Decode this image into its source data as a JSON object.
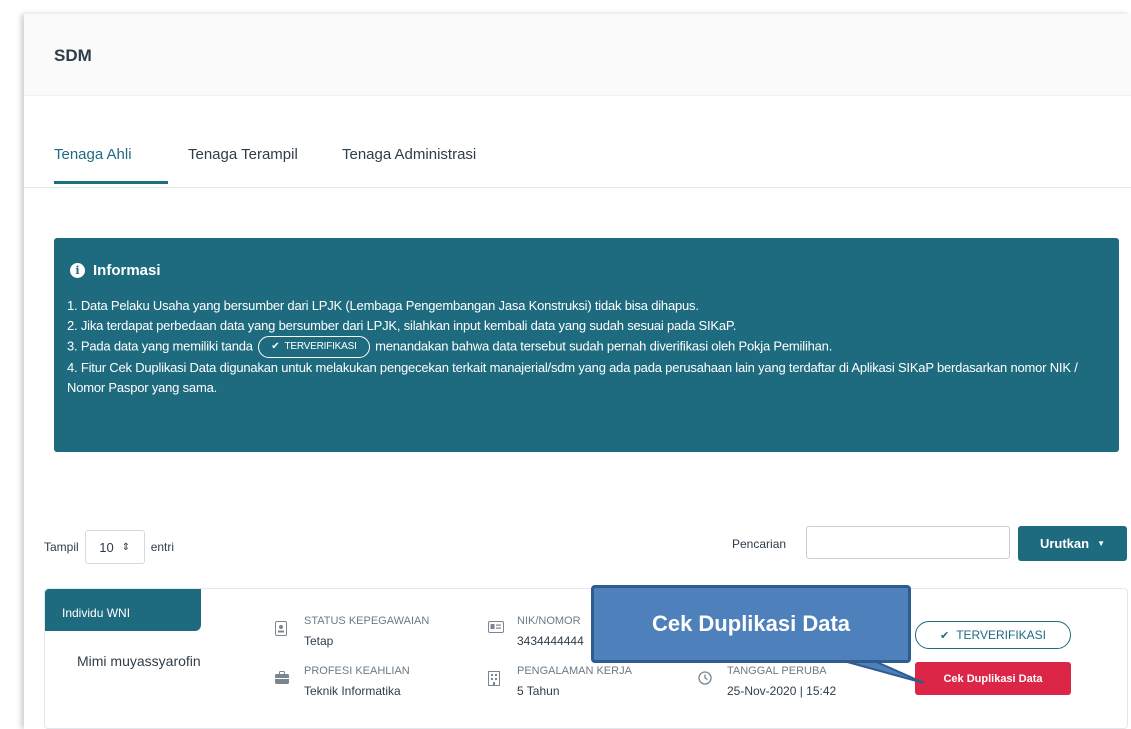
{
  "header": {
    "title": "SDM"
  },
  "tabs": [
    {
      "label": "Tenaga Ahli",
      "active": true
    },
    {
      "label": "Tenaga Terampil",
      "active": false
    },
    {
      "label": "Tenaga Administrasi",
      "active": false
    }
  ],
  "info": {
    "title": "Informasi",
    "icon": "info-circle-icon",
    "items": [
      "1. Data Pelaku Usaha yang bersumber dari LPJK (Lembaga Pengembangan Jasa Konstruksi) tidak bisa dihapus.",
      "2. Jika terdapat perbedaan data yang bersumber dari LPJK, silahkan input kembali data yang sudah sesuai pada SIKaP.",
      "4. Fitur Cek Duplikasi Data digunakan untuk melakukan pengecekan terkait manajerial/sdm yang ada pada perusahaan lain yang terdaftar di Aplikasi SIKaP berdasarkan nomor NIK / Nomor Paspor yang sama."
    ],
    "item3_before": "3. Pada data yang memiliki tanda",
    "item3_badge": "TERVERIFIKASI",
    "item3_after": "menandakan bahwa data tersebut sudah pernah diverifikasi oleh Pokja Pemilihan."
  },
  "table_controls": {
    "show_label": "Tampil",
    "page_size": "10",
    "entries_label": "entri",
    "search_label": "Pencarian",
    "search_value": "",
    "sort_button": "Urutkan"
  },
  "card": {
    "tag": "Individu WNI",
    "name": "Mimi muyassyarofin",
    "status_label": "STATUS KEPEGAWAIAN",
    "status_value": "Tetap",
    "profesi_label": "PROFESI KEAHLIAN",
    "profesi_value": "Teknik Informatika",
    "nik_label": "NIK/NOMOR",
    "nik_value": "3434444444",
    "pengalaman_label": "PENGALAMAN KERJA",
    "pengalaman_value": "5 Tahun",
    "tanggal_label": "TANGGAL PERUBA",
    "tanggal_value": "25-Nov-2020 | 15:42",
    "verified_label": "TERVERIFIKASI",
    "cek_button": "Cek Duplikasi Data"
  },
  "callout": {
    "text": "Cek Duplikasi Data"
  },
  "colors": {
    "primary": "#1e6b7f",
    "danger": "#dc2647",
    "callout": "#4e81bc"
  }
}
